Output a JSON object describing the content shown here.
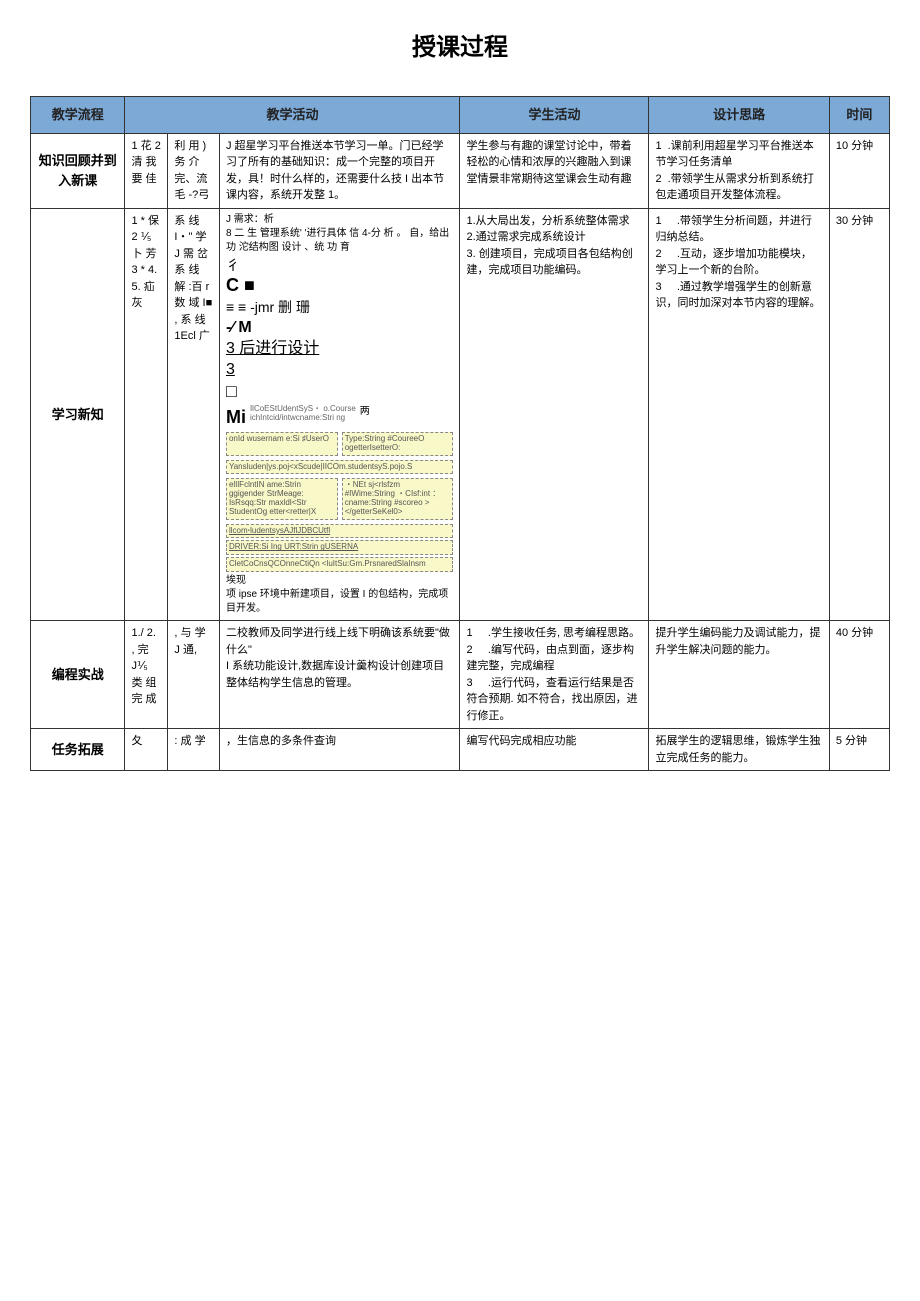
{
  "page_title": "授课过程",
  "headers": {
    "flow": "教学流程",
    "activity": "教学活动",
    "student": "学生活动",
    "design": "设计思路",
    "time": "时间"
  },
  "rows": {
    "row1": {
      "flow": "知识回顾并到入新课",
      "sub1": "1 花 2 清 我 要 佳",
      "sub2": "利 用 ) 务 介 完、流 毛 -?弓",
      "activity": "J 超星学习平台推送本节学习一单。门已经学习了所有的基础知识：成一个完整的项目开发，具！时什么样的，还需要什么技 I 出本节课内容，系统开发整 1。",
      "student": "学生参与有趣的课堂讨论中，带着轻松的心情和浓厚的兴趣融入到课堂情景非常期待这堂课会生动有趣",
      "design": "1  .课前利用超星学习平台推送本节学习任务清单\n2  .带领学生从需求分析到系统打包走通项目开发整体流程。",
      "time": "10 分钟"
    },
    "row2": {
      "flow": "学习新知",
      "sub1": "1 * 保 2 ⅟₅ 卜 芳 3 * 4. 5. 疝 灰",
      "sub2": "系 线 I・\" 学 J 需 岔 系 线 解 :百 r 数 域 I■ , 系 线 1Ecl 广",
      "activity_header": "J 需求：析",
      "activity_p1": "8 二 生 管理系统' '进行具体 信 4-分 析 。 自，给出功 沱结构图 设计 、统 功 育",
      "activity_symbols1": "彳",
      "activity_symbols2": "C     ■",
      "activity_symbols3": "≡  ≡  -jmr 删 珊",
      "activity_symbols4": "-∕   M",
      "activity_symbols5": "3  后进行设计",
      "activity_symbols6": "3",
      "activity_symbols7": "□",
      "activity_mi": "Mi",
      "activity_tinylabel1": "IlCoEStUdentSyS・\no.Course",
      "activity_tinylabel2": "ichIntcid/intwcname:Stri\nng",
      "activity_tinylabel3": "两",
      "activity_box1": "onId\nwusernam\ne:Si\n♯UserO",
      "activity_box2": "Type:String\n#CoureeO\nogetterIsetterO:",
      "activity_box3": "Yansluden|ys.poj<xScude|IICOm.studentsyS.pojo.S",
      "activity_box4": "elIlFclntIN\name:Strin\nggigender\nStrMeage:\nIsRsqq:Str\nmaxldl<Str\nStudentOg\netter<retter|X",
      "activity_box5": "・NEt\nsj<rlsfzm\n#IWime:String\n・CIsf:int\n：cname:String\n#scoreo\n></getterSeKel0>",
      "activity_box6": "llcomꞏludentsysAJflJDBCUtfl",
      "activity_box7": "DRIVER:Si\nIng\nURT:Strin\ngUSERNA",
      "activity_box8": "CletCoCnsQCOnneCtiQn\n<luItSu:Gm.PrsnaredSlaInsm",
      "activity_footer": "项  ipse 环境中新建项目，设置 I 的包结构，完成项目开发。",
      "activity_footer_pre": "埃现",
      "student": "1.从大局出发，分析系统整体需求\n2.通过需求完成系统设计\n3. 创建项目，完成项目各包结构创建，完成项目功能编码。",
      "design": "1     .带领学生分析间题，并进行归纳总结。\n2     .互动，逐步增加功能模块，学习上一个新的台阶。\n3     .通过教学增强学生的创新意识，同时加深对本节内容的理解。",
      "time": "30 分钟"
    },
    "row3": {
      "flow": "编程实战",
      "sub1": "1./ 2. , 完 J⅟₅ 类 组 完 成",
      "sub2": ", 与 学 J 通,",
      "activity": "二校教师及同学进行线上线下明确该系统要\"做什么\"\nI 系统功能设计,数据库设计羹构设计创建项目整体结构学生信息的管理。",
      "student": "1     .学生接收任务, 思考编程思路。\n2     .编写代码，由点到面，逐步构建完整，完成编程\n3     .运行代码，查看运行结果是否符合预期. 如不符合，找出原因，进行修正。",
      "design": "提升学生编码能力及调试能力，提升学生解决问题的能力。",
      "time": "40 分钟"
    },
    "row4": {
      "flow": "任务拓展",
      "sub1": "夂",
      "sub2": ": 成 学",
      "activity": "，生信息的多条件查询",
      "student": "编写代码完成相应功能",
      "design": "拓展学生的逻辑思维，锻炼学生独立完成任务的能力。",
      "time": "5 分钟"
    }
  }
}
